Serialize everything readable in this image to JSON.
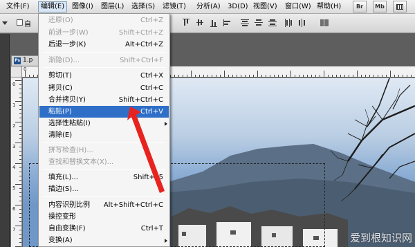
{
  "menubar": {
    "items": [
      "文件(F)",
      "编辑(E)",
      "图像(I)",
      "图层(L)",
      "选择(S)",
      "滤镜(T)",
      "分析(A)",
      "3D(D)",
      "视图(V)",
      "窗口(W)",
      "帮助(H)"
    ],
    "buttons": [
      "Br",
      "Mb"
    ]
  },
  "options_bar": {
    "checkbox_label": "自"
  },
  "document": {
    "tab_label": "1.p",
    "app_badge": "Ps"
  },
  "rulers": {
    "top_numbers": [
      "0"
    ],
    "left_numbers": [
      "0",
      "1",
      "2",
      "3",
      "4",
      "5",
      "6",
      "7"
    ]
  },
  "edit_menu": {
    "items": [
      {
        "label": "还原(O)",
        "shortcut": "Ctrl+Z",
        "disabled": true
      },
      {
        "label": "前进一步(W)",
        "shortcut": "Shift+Ctrl+Z",
        "disabled": true
      },
      {
        "label": "后退一步(K)",
        "shortcut": "Alt+Ctrl+Z",
        "disabled": false
      },
      {
        "label": "渐隐(D)...",
        "shortcut": "Shift+Ctrl+F",
        "disabled": true
      },
      {
        "label": "剪切(T)",
        "shortcut": "Ctrl+X",
        "disabled": false
      },
      {
        "label": "拷贝(C)",
        "shortcut": "Ctrl+C",
        "disabled": false
      },
      {
        "label": "合并拷贝(Y)",
        "shortcut": "Shift+Ctrl+C",
        "disabled": false
      },
      {
        "label": "粘贴(P)",
        "shortcut": "Ctrl+V",
        "disabled": false,
        "highlighted": true
      },
      {
        "label": "选择性粘贴(I)",
        "shortcut": "",
        "disabled": false,
        "submenu": true
      },
      {
        "label": "清除(E)",
        "shortcut": "",
        "disabled": false
      },
      {
        "label": "拼写检查(H)...",
        "shortcut": "",
        "disabled": true
      },
      {
        "label": "查找和替换文本(X)...",
        "shortcut": "",
        "disabled": true
      },
      {
        "label": "填充(L)...",
        "shortcut": "Shift+F5",
        "disabled": false
      },
      {
        "label": "描边(S)...",
        "shortcut": "",
        "disabled": false
      },
      {
        "label": "内容识别比例",
        "shortcut": "Alt+Shift+Ctrl+C",
        "disabled": false
      },
      {
        "label": "操控变形",
        "shortcut": "",
        "disabled": false
      },
      {
        "label": "自由变换(F)",
        "shortcut": "Ctrl+T",
        "disabled": false
      },
      {
        "label": "变换(A)",
        "shortcut": "",
        "disabled": false,
        "submenu": true
      }
    ]
  },
  "watermark": "爱到根知识网",
  "colors": {
    "highlight": "#2f6fc8",
    "arrow": "#e8231f",
    "disabled_text": "#9a9a9a"
  }
}
